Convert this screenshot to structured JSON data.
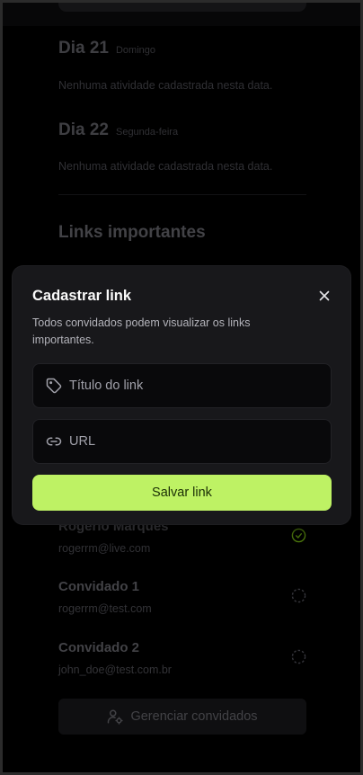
{
  "days": [
    {
      "title": "Dia 21",
      "weekday": "Domingo",
      "empty_text": "Nenhuma atividade cadastrada nesta data."
    },
    {
      "title": "Dia 22",
      "weekday": "Segunda-feira",
      "empty_text": "Nenhuma atividade cadastrada nesta data."
    }
  ],
  "links_section": {
    "title": "Links importantes"
  },
  "guests": [
    {
      "name": "Rogerio Marques",
      "email": "rogerrm@live.com",
      "confirmed": true
    },
    {
      "name": "Convidado 1",
      "email": "rogerrm@test.com",
      "confirmed": false
    },
    {
      "name": "Convidado 2",
      "email": "john_doe@test.com.br",
      "confirmed": false
    }
  ],
  "manage_button": {
    "label": "Gerenciar convidados",
    "icon": "user-cog-icon"
  },
  "modal": {
    "title": "Cadastrar link",
    "description": "Todos convidados podem visualizar os links importantes.",
    "title_field": {
      "placeholder": "Título do link",
      "value": "",
      "icon": "tag-icon"
    },
    "url_field": {
      "placeholder": "URL",
      "value": "",
      "icon": "link-icon"
    },
    "submit_label": "Salvar link",
    "close_icon": "close-icon"
  },
  "colors": {
    "accent": "#bef264",
    "accent_text": "#1a2e05",
    "background": "#000000",
    "surface": "#18181b",
    "field_bg": "#09090b",
    "confirmed_check": "#84cc16"
  }
}
